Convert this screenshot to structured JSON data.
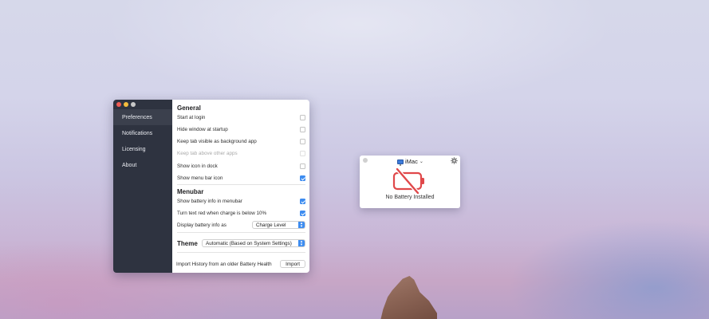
{
  "prefs": {
    "sidebar": {
      "items": [
        {
          "label": "Preferences",
          "active": true
        },
        {
          "label": "Notifications",
          "active": false
        },
        {
          "label": "Licensing",
          "active": false
        },
        {
          "label": "About",
          "active": false
        }
      ]
    },
    "general": {
      "title": "General",
      "start_at_login": {
        "label": "Start at login",
        "checked": false
      },
      "hide_window": {
        "label": "Hide window at startup",
        "checked": false
      },
      "keep_tab_visible": {
        "label": "Keep tab visible as background app",
        "checked": false
      },
      "keep_tab_above": {
        "label": "Keep tab above other apps",
        "checked": false,
        "enabled": false
      },
      "show_icon_dock": {
        "label": "Show icon in dock",
        "checked": false
      },
      "show_menu_bar_icon": {
        "label": "Show menu bar icon",
        "checked": true
      }
    },
    "menubar": {
      "title": "Menubar",
      "show_battery_info": {
        "label": "Show battery info in menubar",
        "checked": true
      },
      "turn_text_red": {
        "label": "Turn text red when charge is below 10%",
        "checked": true
      },
      "display_as": {
        "label": "Display battery info as",
        "value": "Charge Level"
      }
    },
    "theme": {
      "title": "Theme",
      "value": "Automatic (Based on System Settings)"
    },
    "import": {
      "label": "Import History from an older Battery Health",
      "button": "Import"
    }
  },
  "widget": {
    "device": "iMac",
    "status": "No Battery Installed",
    "icons": {
      "settings": "gear-icon",
      "battery": "battery-slash-icon",
      "device": "imac-icon"
    },
    "colors": {
      "battery_slash": "#e0484a"
    }
  }
}
